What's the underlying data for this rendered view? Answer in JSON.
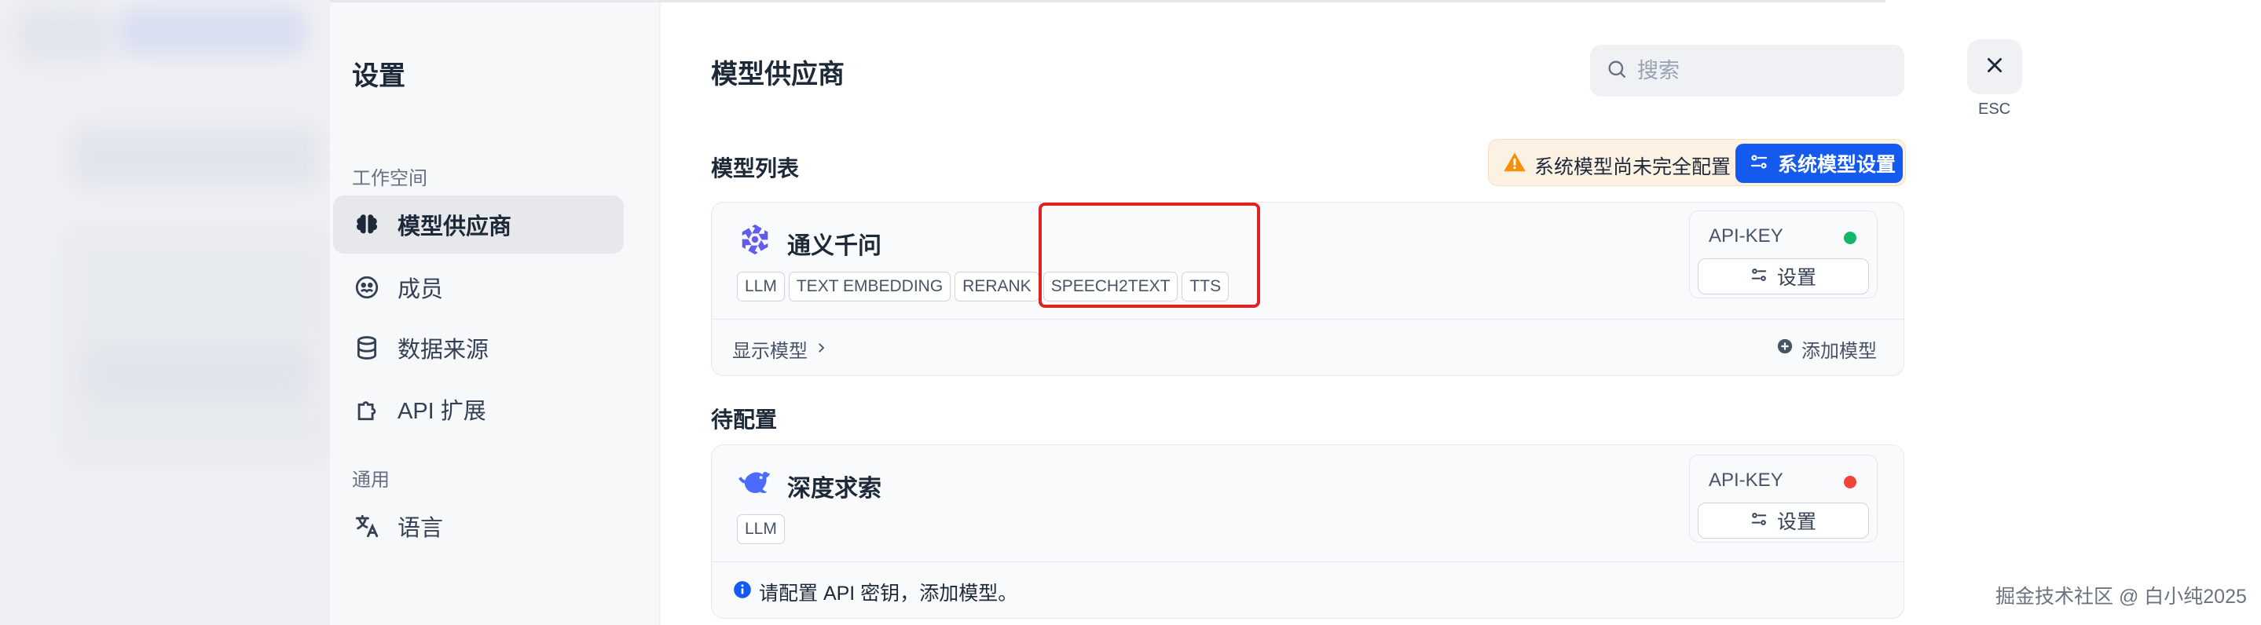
{
  "settings": {
    "title": "设置",
    "groups": [
      {
        "label": "工作空间"
      },
      {
        "label": "通用"
      }
    ],
    "items": [
      {
        "label": "模型供应商",
        "icon": "brain-icon",
        "active": true
      },
      {
        "label": "成员",
        "icon": "members-icon"
      },
      {
        "label": "数据来源",
        "icon": "database-icon"
      },
      {
        "label": "API 扩展",
        "icon": "puzzle-icon"
      },
      {
        "label": "语言",
        "icon": "translate-icon"
      }
    ]
  },
  "main": {
    "title": "模型供应商",
    "search": {
      "placeholder": "搜索",
      "icon": "search-icon"
    },
    "model_list_label": "模型列表",
    "warning_text": "系统模型尚未完全配置",
    "system_model_button": "系统模型设置",
    "pending_label": "待配置",
    "colors": {
      "accent": "#155aef",
      "warning": "#f79009",
      "ok": "#12b76a",
      "error": "#f04438",
      "highlight": "#e02222"
    }
  },
  "providers": [
    {
      "name": "通义千问",
      "logo": "tongyi-logo",
      "tags": [
        "LLM",
        "TEXT EMBEDDING",
        "RERANK",
        "SPEECH2TEXT",
        "TTS"
      ],
      "api_label": "API-KEY",
      "status": "ok",
      "settings_label": "设置",
      "show_models": "显示模型",
      "add_model": "添加模型"
    },
    {
      "name": "深度求索",
      "logo": "deepseek-logo",
      "tags": [
        "LLM"
      ],
      "api_label": "API-KEY",
      "status": "error",
      "settings_label": "设置",
      "info": "请配置 API 密钥，添加模型。"
    }
  ],
  "close": {
    "label": "ESC",
    "icon": "close-icon"
  },
  "watermark": "掘金技术社区 @ 白小纯2025"
}
